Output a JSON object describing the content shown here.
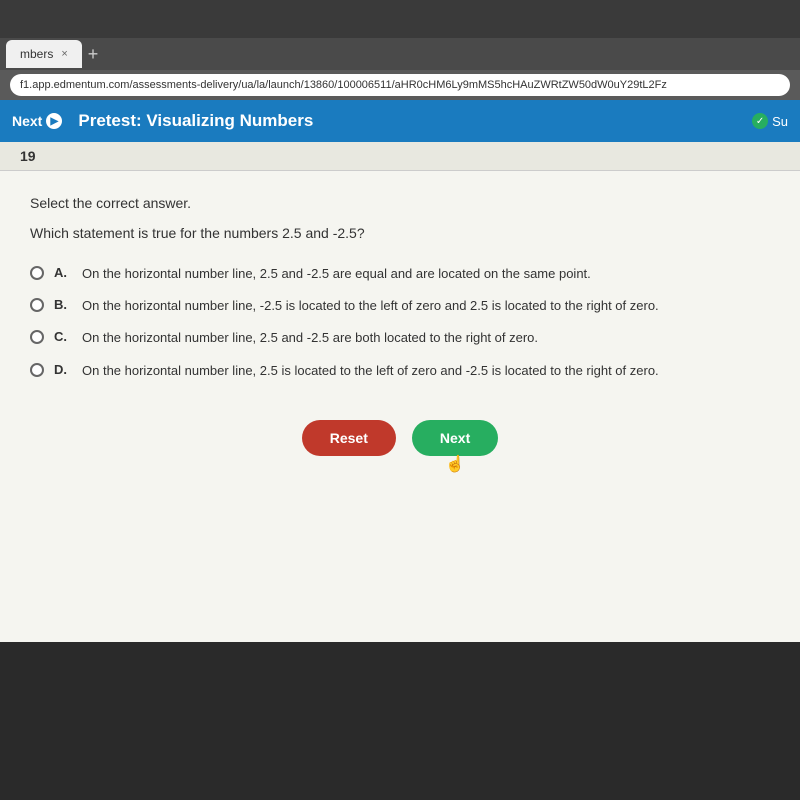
{
  "browser": {
    "tab_label": "mbers",
    "tab_close": "×",
    "tab_add": "+",
    "address": "f1.app.edmentum.com/assessments-delivery/ua/la/launch/13860/100006511/aHR0cHM6Ly9mMS5hcHAuZWRtZW50dW0uY29tL2Fz"
  },
  "header": {
    "next_label": "Next",
    "next_arrow": "▶",
    "title": "Pretest: Visualizing Numbers",
    "submit_label": "Su",
    "submit_check": "✓"
  },
  "question": {
    "number": "19",
    "instruction": "Select the correct answer.",
    "question_text": "Which statement is true for the numbers 2.5 and -2.5?",
    "options": [
      {
        "id": "A",
        "text": "On the horizontal number line, 2.5 and -2.5 are equal and are located on the same point."
      },
      {
        "id": "B",
        "text": "On the horizontal number line, -2.5 is located to the left of zero and 2.5 is located to the right of zero."
      },
      {
        "id": "C",
        "text": "On the horizontal number line, 2.5 and -2.5 are both located to the right of zero."
      },
      {
        "id": "D",
        "text": "On the horizontal number line, 2.5 is located to the left of zero and -2.5 is located to the right of zero."
      }
    ]
  },
  "buttons": {
    "reset_label": "Reset",
    "next_label": "Next"
  }
}
